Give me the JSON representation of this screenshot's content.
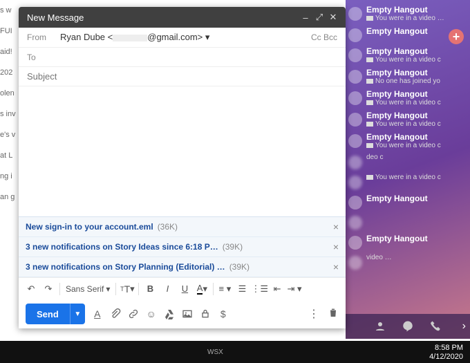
{
  "compose": {
    "title": "New Message",
    "from_label": "From",
    "from_name": "Ryan Dube <",
    "from_domain": "@gmail.com>",
    "to_label": "To",
    "subject_placeholder": "Subject",
    "cc_label": "Cc",
    "bcc_label": "Bcc",
    "font_family": "Sans Serif",
    "send_label": "Send",
    "attachments": [
      {
        "name": "New sign-in to your account.eml",
        "size": "(36K)"
      },
      {
        "name": "3 new notifications on Story Ideas since 6:18 P…",
        "size": "(39K)"
      },
      {
        "name": "3 new notifications on Story Planning (Editorial) …",
        "size": "(39K)"
      }
    ]
  },
  "hangouts": {
    "items": [
      {
        "title": "Empty Hangout",
        "sub": "You were in a video …"
      },
      {
        "title": "Empty Hangout",
        "sub": ""
      },
      {
        "title": "Empty Hangout",
        "sub": "You were in a video c"
      },
      {
        "title": "Empty Hangout",
        "sub": "No one has joined yo"
      },
      {
        "title": "Empty Hangout",
        "sub": "You were in a video c"
      },
      {
        "title": "Empty Hangout",
        "sub": "You were in a video c"
      },
      {
        "title": "Empty Hangout",
        "sub": "You were in a video c"
      },
      {
        "title": "",
        "sub": "deo c"
      },
      {
        "title": "",
        "sub": "You were in a video c"
      },
      {
        "title": "Empty Hangout",
        "sub": ""
      },
      {
        "title": "",
        "sub": ""
      },
      {
        "title": "Empty Hangout",
        "sub": ""
      },
      {
        "title": "",
        "sub": "video …"
      }
    ]
  },
  "taskbar": {
    "time": "8:58 PM",
    "date": "4/12/2020",
    "watermark": "WSX"
  },
  "left_fragments": [
    "s w",
    "",
    "FUI",
    "",
    "aid!",
    "",
    "202",
    "",
    "",
    "olen",
    "",
    "s inv",
    "",
    "",
    "",
    "e's v",
    "",
    "",
    "",
    "",
    "at L",
    "",
    "ng i",
    "",
    "an g"
  ]
}
